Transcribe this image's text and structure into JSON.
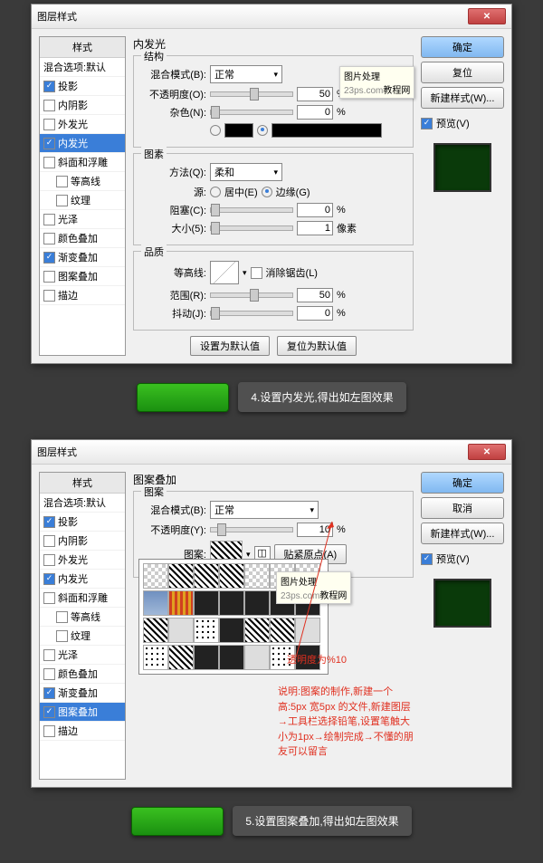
{
  "dialog1": {
    "title": "图层样式",
    "styles_header": "样式",
    "blend_default": "混合选项:默认",
    "items": [
      {
        "label": "投影",
        "checked": true
      },
      {
        "label": "内阴影",
        "checked": false
      },
      {
        "label": "外发光",
        "checked": false
      },
      {
        "label": "内发光",
        "checked": true,
        "selected": true
      },
      {
        "label": "斜面和浮雕",
        "checked": false
      },
      {
        "label": "等高线",
        "checked": false,
        "indent": true
      },
      {
        "label": "纹理",
        "checked": false,
        "indent": true
      },
      {
        "label": "光泽",
        "checked": false
      },
      {
        "label": "颜色叠加",
        "checked": false
      },
      {
        "label": "渐变叠加",
        "checked": true
      },
      {
        "label": "图案叠加",
        "checked": false
      },
      {
        "label": "描边",
        "checked": false
      }
    ],
    "panel_title": "内发光",
    "g_struct": "结构",
    "blend_mode_label": "混合模式(B):",
    "blend_mode_val": "正常",
    "opacity_label": "不透明度(O):",
    "opacity_val": "50",
    "noise_label": "杂色(N):",
    "noise_val": "0",
    "g_elem": "图素",
    "method_label": "方法(Q):",
    "method_val": "柔和",
    "source_label": "源:",
    "source_center": "居中(E)",
    "source_edge": "边缘(G)",
    "choke_label": "阻塞(C):",
    "choke_val": "0",
    "size_label": "大小(5):",
    "size_val": "1",
    "px": "像素",
    "g_quality": "品质",
    "contour_label": "等高线:",
    "antialias": "消除锯齿(L)",
    "range_label": "范围(R):",
    "range_val": "50",
    "jitter_label": "抖动(J):",
    "jitter_val": "0",
    "pct": "%",
    "btn_default": "设置为默认值",
    "btn_reset": "复位为默认值",
    "btn_ok": "确定",
    "btn_cancel": "复位",
    "btn_newstyle": "新建样式(W)...",
    "preview_label": "预览(V)",
    "tooltip": "图片处理",
    "tooltip2": "教程网"
  },
  "caption1": "4.设置内发光,得出如左图效果",
  "dialog2": {
    "title": "图层样式",
    "styles_header": "样式",
    "blend_default": "混合选项:默认",
    "items": [
      {
        "label": "投影",
        "checked": true
      },
      {
        "label": "内阴影",
        "checked": false
      },
      {
        "label": "外发光",
        "checked": false
      },
      {
        "label": "内发光",
        "checked": true
      },
      {
        "label": "斜面和浮雕",
        "checked": false
      },
      {
        "label": "等高线",
        "checked": false,
        "indent": true
      },
      {
        "label": "纹理",
        "checked": false,
        "indent": true
      },
      {
        "label": "光泽",
        "checked": false
      },
      {
        "label": "颜色叠加",
        "checked": false
      },
      {
        "label": "渐变叠加",
        "checked": true
      },
      {
        "label": "图案叠加",
        "checked": true,
        "selected": true
      },
      {
        "label": "描边",
        "checked": false
      }
    ],
    "panel_title": "图案叠加",
    "g_pattern": "图案",
    "blend_mode_label": "混合模式(B):",
    "blend_mode_val": "正常",
    "opacity_label": "不透明度(Y):",
    "opacity_val": "10",
    "pattern_label": "图案:",
    "snap_label": "贴紧原点(A)",
    "pct": "%",
    "btn_ok": "确定",
    "btn_cancel": "取消",
    "btn_newstyle": "新建样式(W)...",
    "preview_label": "预览(V)",
    "tooltip": "图片处理",
    "tooltip2": "教程网",
    "annotation1": "透明度为%10",
    "annotation2": "说明:图案的制作,新建一个高:5px 宽5px 的文件,新建图层→工具栏选择铅笔,设置笔触大小为1px→绘制完成→不懂的朋友可以留言"
  },
  "caption2": "5.设置图案叠加,得出如左图效果"
}
